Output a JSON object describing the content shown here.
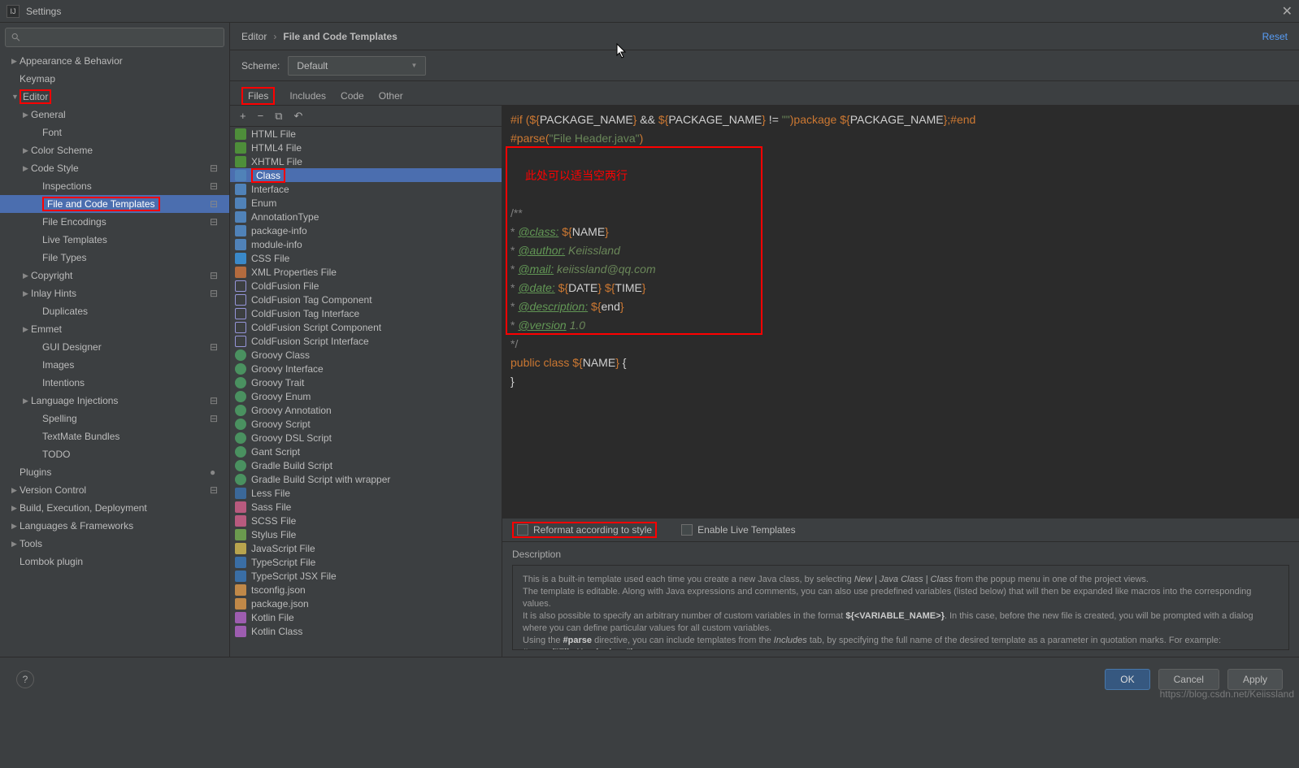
{
  "window": {
    "title": "Settings"
  },
  "search": {
    "placeholder": ""
  },
  "tree": [
    {
      "label": "Appearance & Behavior",
      "depth": 0,
      "arrow": "▶"
    },
    {
      "label": "Keymap",
      "depth": 0,
      "arrow": ""
    },
    {
      "label": "Editor",
      "depth": 0,
      "arrow": "▼",
      "boxed": true
    },
    {
      "label": "General",
      "depth": 1,
      "arrow": "▶"
    },
    {
      "label": "Font",
      "depth": 2,
      "arrow": ""
    },
    {
      "label": "Color Scheme",
      "depth": 1,
      "arrow": "▶"
    },
    {
      "label": "Code Style",
      "depth": 1,
      "arrow": "▶",
      "badge": true
    },
    {
      "label": "Inspections",
      "depth": 2,
      "arrow": "",
      "badge": true
    },
    {
      "label": "File and Code Templates",
      "depth": 2,
      "arrow": "",
      "badge": true,
      "selected": true,
      "boxed": true
    },
    {
      "label": "File Encodings",
      "depth": 2,
      "arrow": "",
      "badge": true
    },
    {
      "label": "Live Templates",
      "depth": 2,
      "arrow": ""
    },
    {
      "label": "File Types",
      "depth": 2,
      "arrow": ""
    },
    {
      "label": "Copyright",
      "depth": 1,
      "arrow": "▶",
      "badge": true
    },
    {
      "label": "Inlay Hints",
      "depth": 1,
      "arrow": "▶",
      "badge": true
    },
    {
      "label": "Duplicates",
      "depth": 2,
      "arrow": ""
    },
    {
      "label": "Emmet",
      "depth": 1,
      "arrow": "▶"
    },
    {
      "label": "GUI Designer",
      "depth": 2,
      "arrow": "",
      "badge": true
    },
    {
      "label": "Images",
      "depth": 2,
      "arrow": ""
    },
    {
      "label": "Intentions",
      "depth": 2,
      "arrow": ""
    },
    {
      "label": "Language Injections",
      "depth": 1,
      "arrow": "▶",
      "badge": true
    },
    {
      "label": "Spelling",
      "depth": 2,
      "arrow": "",
      "badge": true
    },
    {
      "label": "TextMate Bundles",
      "depth": 2,
      "arrow": ""
    },
    {
      "label": "TODO",
      "depth": 2,
      "arrow": ""
    },
    {
      "label": "Plugins",
      "depth": 0,
      "arrow": "",
      "count": true
    },
    {
      "label": "Version Control",
      "depth": 0,
      "arrow": "▶",
      "badge": true
    },
    {
      "label": "Build, Execution, Deployment",
      "depth": 0,
      "arrow": "▶"
    },
    {
      "label": "Languages & Frameworks",
      "depth": 0,
      "arrow": "▶"
    },
    {
      "label": "Tools",
      "depth": 0,
      "arrow": "▶"
    },
    {
      "label": "Lombok plugin",
      "depth": 0,
      "arrow": ""
    }
  ],
  "breadcrumb": {
    "root": "Editor",
    "leaf": "File and Code Templates",
    "reset": "Reset"
  },
  "scheme": {
    "label": "Scheme:",
    "value": "Default"
  },
  "tabs": [
    "Files",
    "Includes",
    "Code",
    "Other"
  ],
  "toolbar": {
    "add": "+",
    "remove": "−",
    "copy": "⧉",
    "revert": "↶"
  },
  "files": [
    {
      "label": "HTML File",
      "icon": "html"
    },
    {
      "label": "HTML4 File",
      "icon": "html"
    },
    {
      "label": "XHTML File",
      "icon": "html"
    },
    {
      "label": "Class",
      "icon": "java",
      "selected": true,
      "boxed": true
    },
    {
      "label": "Interface",
      "icon": "java"
    },
    {
      "label": "Enum",
      "icon": "java"
    },
    {
      "label": "AnnotationType",
      "icon": "java"
    },
    {
      "label": "package-info",
      "icon": "java"
    },
    {
      "label": "module-info",
      "icon": "java"
    },
    {
      "label": "CSS File",
      "icon": "css"
    },
    {
      "label": "XML Properties File",
      "icon": "xml"
    },
    {
      "label": "ColdFusion File",
      "icon": "cf"
    },
    {
      "label": "ColdFusion Tag Component",
      "icon": "cf"
    },
    {
      "label": "ColdFusion Tag Interface",
      "icon": "cf"
    },
    {
      "label": "ColdFusion Script Component",
      "icon": "cf"
    },
    {
      "label": "ColdFusion Script Interface",
      "icon": "cf"
    },
    {
      "label": "Groovy Class",
      "icon": "groovy"
    },
    {
      "label": "Groovy Interface",
      "icon": "groovy"
    },
    {
      "label": "Groovy Trait",
      "icon": "groovy"
    },
    {
      "label": "Groovy Enum",
      "icon": "groovy"
    },
    {
      "label": "Groovy Annotation",
      "icon": "groovy"
    },
    {
      "label": "Groovy Script",
      "icon": "groovy"
    },
    {
      "label": "Groovy DSL Script",
      "icon": "groovy"
    },
    {
      "label": "Gant Script",
      "icon": "groovy"
    },
    {
      "label": "Gradle Build Script",
      "icon": "groovy"
    },
    {
      "label": "Gradle Build Script with wrapper",
      "icon": "groovy"
    },
    {
      "label": "Less File",
      "icon": "less"
    },
    {
      "label": "Sass File",
      "icon": "sass"
    },
    {
      "label": "SCSS File",
      "icon": "sass"
    },
    {
      "label": "Stylus File",
      "icon": "stylus"
    },
    {
      "label": "JavaScript File",
      "icon": "js"
    },
    {
      "label": "TypeScript File",
      "icon": "ts"
    },
    {
      "label": "TypeScript JSX File",
      "icon": "ts"
    },
    {
      "label": "tsconfig.json",
      "icon": "json"
    },
    {
      "label": "package.json",
      "icon": "json"
    },
    {
      "label": "Kotlin File",
      "icon": "kt"
    },
    {
      "label": "Kotlin Class",
      "icon": "kt"
    }
  ],
  "code": {
    "l1a": "#if ",
    "l1b": "(",
    "l1c": "${",
    "l1d": "PACKAGE_NAME",
    "l1e": "}",
    "l1f": " && ",
    "l1g": "${",
    "l1h": "PACKAGE_NAME",
    "l1i": "}",
    "l1j": " != ",
    "l1k": "\"\"",
    "l1l": ")",
    "l1m": "package ",
    "l1n": "${",
    "l1o": "PACKAGE_NAME",
    "l1p": "}",
    "l1q": ";",
    "l1r": "#end",
    "l2a": "#parse",
    "l2b": "(",
    "l2c": "\"File Header.java\"",
    "l2d": ")",
    "annotation": "此处可以适当空两行",
    "l3": "/**",
    "l4a": " * ",
    "l4b": "@class:",
    "l4c": " ${",
    "l4d": "NAME",
    "l4e": "}",
    "l5a": " * ",
    "l5b": "@author:",
    "l5c": " Keiissland",
    "l6a": " * ",
    "l6b": "@mail:",
    "l6c": " keiissland@qq.com",
    "l7a": " * ",
    "l7b": "@date:",
    "l7c": " ${",
    "l7d": "DATE",
    "l7e": "}",
    "l7f": " ${",
    "l7g": "TIME",
    "l7h": "}",
    "l8a": " * ",
    "l8b": "@description:",
    "l8c": " ${",
    "l8d": "end",
    "l8e": "}",
    "l9a": " * ",
    "l9b": "@version",
    "l9c": " 1.0",
    "l10": " */",
    "l11a": "public class ",
    "l11b": "${",
    "l11c": "NAME",
    "l11d": "}",
    "l11e": " {",
    "l12": "}"
  },
  "checkboxes": {
    "reformat": "Reformat according to style",
    "live": "Enable Live Templates"
  },
  "description": {
    "title": "Description",
    "p1a": "This is a built-in template used each time you create a new Java class, by selecting ",
    "p1b": "New | Java Class | Class",
    "p1c": " from the popup menu in one of the project views.",
    "p2": "The template is editable. Along with Java expressions and comments, you can also use predefined variables (listed below) that will then be expanded like macros into the corresponding values.",
    "p3a": "It is also possible to specify an arbitrary number of custom variables in the format ",
    "p3b": "${<VARIABLE_NAME>}",
    "p3c": ". In this case, before the new file is created, you will be prompted with a dialog where you can define particular values for all custom variables.",
    "p4a": "Using the ",
    "p4b": "#parse",
    "p4c": " directive, you can include templates from the ",
    "p4d": "Includes",
    "p4e": " tab, by specifying the full name of the desired template as a parameter in quotation marks. For example:",
    "p5": "#parse(\"File Header.java\")"
  },
  "buttons": {
    "ok": "OK",
    "cancel": "Cancel",
    "apply": "Apply"
  },
  "watermark": "https://blog.csdn.net/Keiissland"
}
